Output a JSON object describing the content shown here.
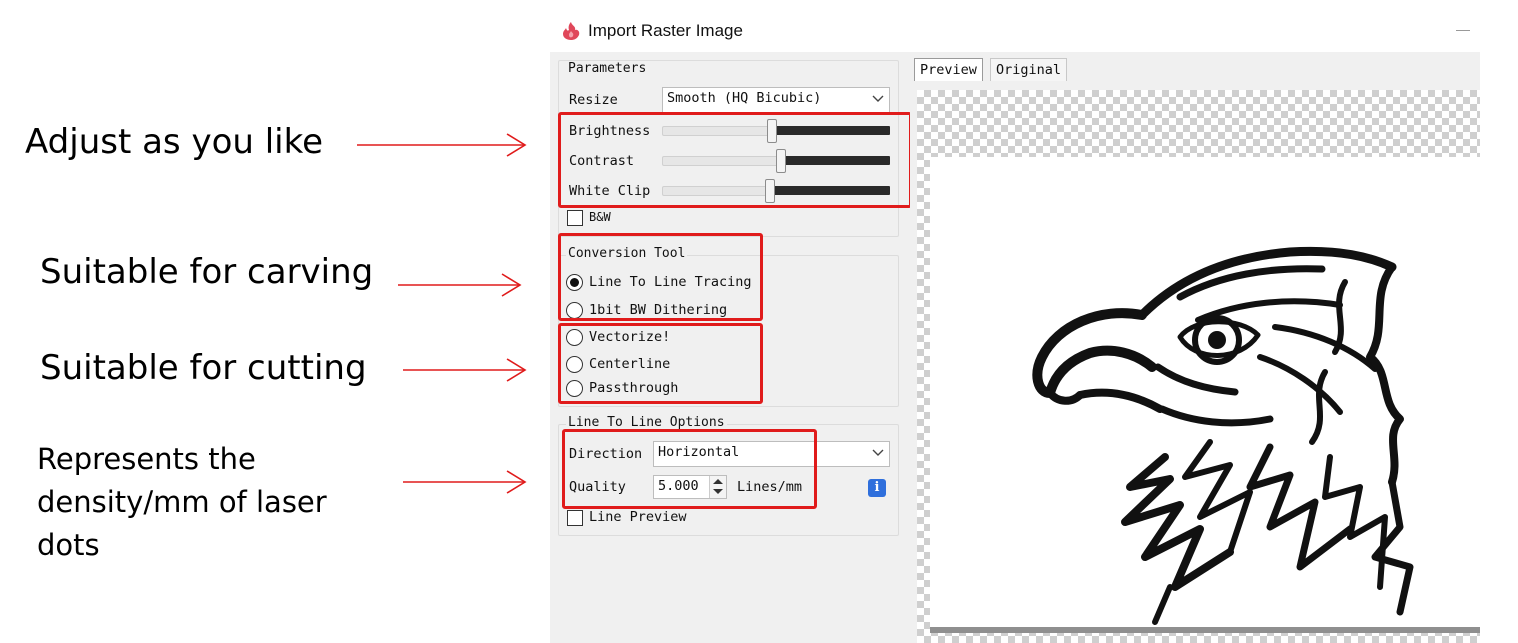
{
  "annotations": {
    "adjust": "Adjust as you like",
    "carving": "Suitable for carving",
    "cutting": "Suitable for cutting",
    "density": "Represents the density/mm of laser dots"
  },
  "window": {
    "title": "Import Raster Image",
    "app_icon": "lightburn-flame-icon"
  },
  "parameters": {
    "group_label": "Parameters",
    "resize_label": "Resize",
    "resize_value": "Smooth (HQ Bicubic)",
    "sliders": [
      {
        "label": "Brightness",
        "value": 0.47
      },
      {
        "label": "Contrast",
        "value": 0.51
      },
      {
        "label": "White Clip",
        "value": 0.46
      }
    ],
    "bw_label": "B&W",
    "bw_checked": false
  },
  "conversion": {
    "group_label": "Conversion Tool",
    "options": [
      {
        "label": "Line To Line Tracing",
        "selected": true
      },
      {
        "label": "1bit BW Dithering",
        "selected": false
      },
      {
        "label": "Vectorize!",
        "selected": false
      },
      {
        "label": "Centerline",
        "selected": false
      },
      {
        "label": "Passthrough",
        "selected": false
      }
    ]
  },
  "line_options": {
    "group_label": "Line To Line Options",
    "direction_label": "Direction",
    "direction_value": "Horizontal",
    "quality_label": "Quality",
    "quality_value": "5.000",
    "quality_unit": "Lines/mm",
    "line_preview_label": "Line Preview",
    "line_preview_checked": false
  },
  "preview": {
    "tabs": [
      "Preview",
      "Original"
    ],
    "active_tab": "Preview",
    "image": "eagle-head-image"
  },
  "colors": {
    "annotation_red": "#e01b1b",
    "info_blue": "#2f6fdc",
    "panel_bg": "#f0f0f0"
  }
}
